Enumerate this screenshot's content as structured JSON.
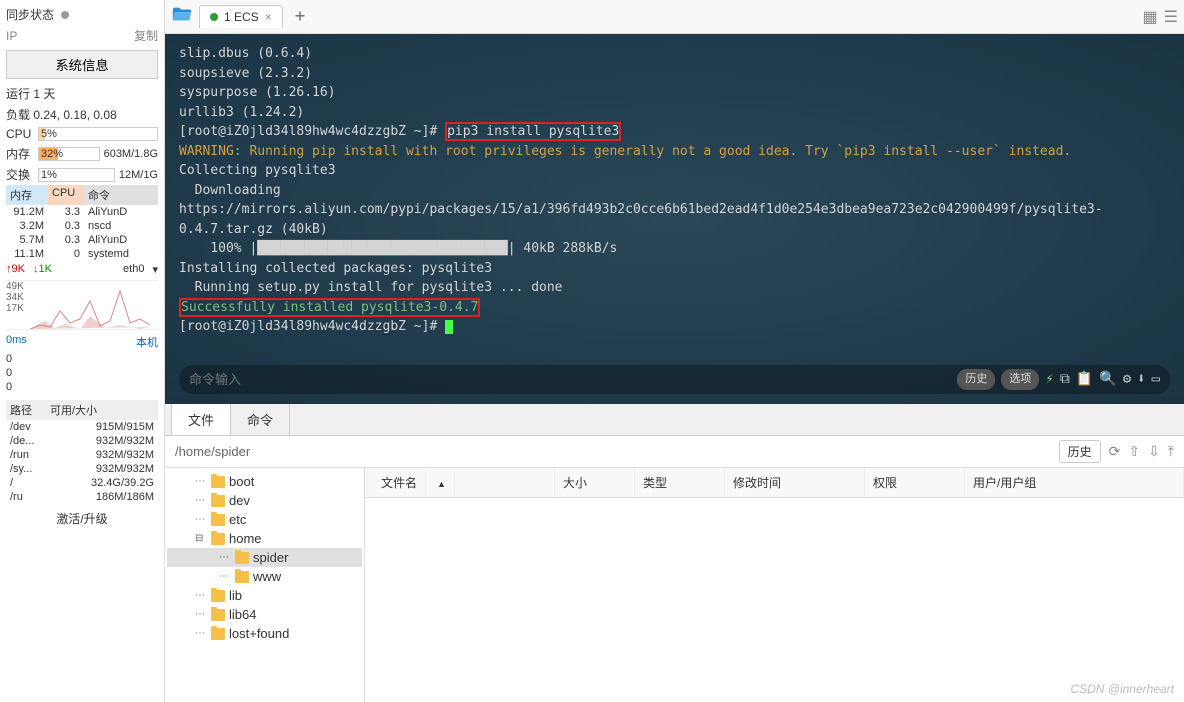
{
  "sidebar": {
    "sync_label": "同步状态",
    "ip_label": "IP",
    "copy": "复制",
    "sysinfo_btn": "系统信息",
    "uptime": "运行 1 天",
    "load": "负载 0.24, 0.18, 0.08",
    "cpu_label": "CPU",
    "cpu_pct": "5%",
    "mem_label": "内存",
    "mem_pct": "32%",
    "mem_extra": "603M/1.8G",
    "swap_label": "交换",
    "swap_pct": "1%",
    "swap_extra": "12M/1G",
    "proc_headers": {
      "mem": "内存",
      "cpu": "CPU",
      "cmd": "命令"
    },
    "procs": [
      {
        "mem": "91.2M",
        "cpu": "3.3",
        "cmd": "AliYunD"
      },
      {
        "mem": "3.2M",
        "cpu": "0.3",
        "cmd": "nscd"
      },
      {
        "mem": "5.7M",
        "cpu": "0.3",
        "cmd": "AliYunD"
      },
      {
        "mem": "11.1M",
        "cpu": "0",
        "cmd": "systemd"
      }
    ],
    "net_up": "9K",
    "net_down": "1K",
    "net_if": "eth0",
    "y_labels": [
      "49K",
      "34K",
      "17K"
    ],
    "ms": "0ms",
    "local": "本机",
    "zeros": [
      "0",
      "0",
      "0"
    ],
    "path_hdr": {
      "path": "路径",
      "size": "可用/大小"
    },
    "paths": [
      {
        "p": "/dev",
        "s": "915M/915M"
      },
      {
        "p": "/de...",
        "s": "932M/932M"
      },
      {
        "p": "/run",
        "s": "932M/932M"
      },
      {
        "p": "/sy...",
        "s": "932M/932M"
      },
      {
        "p": "/",
        "s": "32.4G/39.2G"
      },
      {
        "p": "/ru",
        "s": "186M/186M"
      }
    ],
    "activate": "激活/升级"
  },
  "tabs": {
    "tab1": "1 ECS"
  },
  "terminal": {
    "lines": {
      "l1": "slip.dbus (0.6.4)",
      "l2": "soupsieve (2.3.2)",
      "l3": "syspurpose (1.26.16)",
      "l4": "urllib3 (1.24.2)",
      "prompt1": "[root@iZ0jld34l89hw4wc4dzzgbZ ~]# ",
      "cmd1": "pip3 install pysqlite3",
      "warn": "WARNING: Running pip install with root privileges is generally not a good idea. Try `pip3 install --user` instead.",
      "l6": "Collecting pysqlite3",
      "l7": "  Downloading https://mirrors.aliyun.com/pypi/packages/15/a1/396fd493b2c0cce6b61bed2ead4f1d0e254e3dbea9ea723e2c042900499f/pysqlite3-0.4.7.tar.gz (40kB)",
      "prog_pct": "    100% ",
      "prog_bar": "|████████████████████████████████|",
      "prog_sz": " 40kB 288kB/s",
      "l9": "Installing collected packages: pysqlite3",
      "l10": "  Running setup.py install for pysqlite3 ... done",
      "success": "Successfully installed pysqlite3-0.4.7",
      "prompt2": "[root@iZ0jld34l89hw4wc4dzzgbZ ~]# "
    },
    "input_placeholder": "命令输入",
    "history": "历史",
    "options": "选项"
  },
  "filetabs": {
    "files": "文件",
    "cmd": "命令"
  },
  "pathbar": {
    "path": "/home/spider",
    "history": "历史"
  },
  "tree": [
    {
      "name": "boot",
      "ind": 20
    },
    {
      "name": "dev",
      "ind": 20
    },
    {
      "name": "etc",
      "ind": 20
    },
    {
      "name": "home",
      "ind": 20,
      "exp": "⊟"
    },
    {
      "name": "spider",
      "ind": 44,
      "sel": true
    },
    {
      "name": "www",
      "ind": 44
    },
    {
      "name": "lib",
      "ind": 20
    },
    {
      "name": "lib64",
      "ind": 20
    },
    {
      "name": "lost+found",
      "ind": 20
    }
  ],
  "filelist_hdr": {
    "name": "文件名",
    "size": "大小",
    "type": "类型",
    "mtime": "修改时间",
    "perm": "权限",
    "owner": "用户/用户组"
  },
  "watermark": "CSDN @innerheart"
}
